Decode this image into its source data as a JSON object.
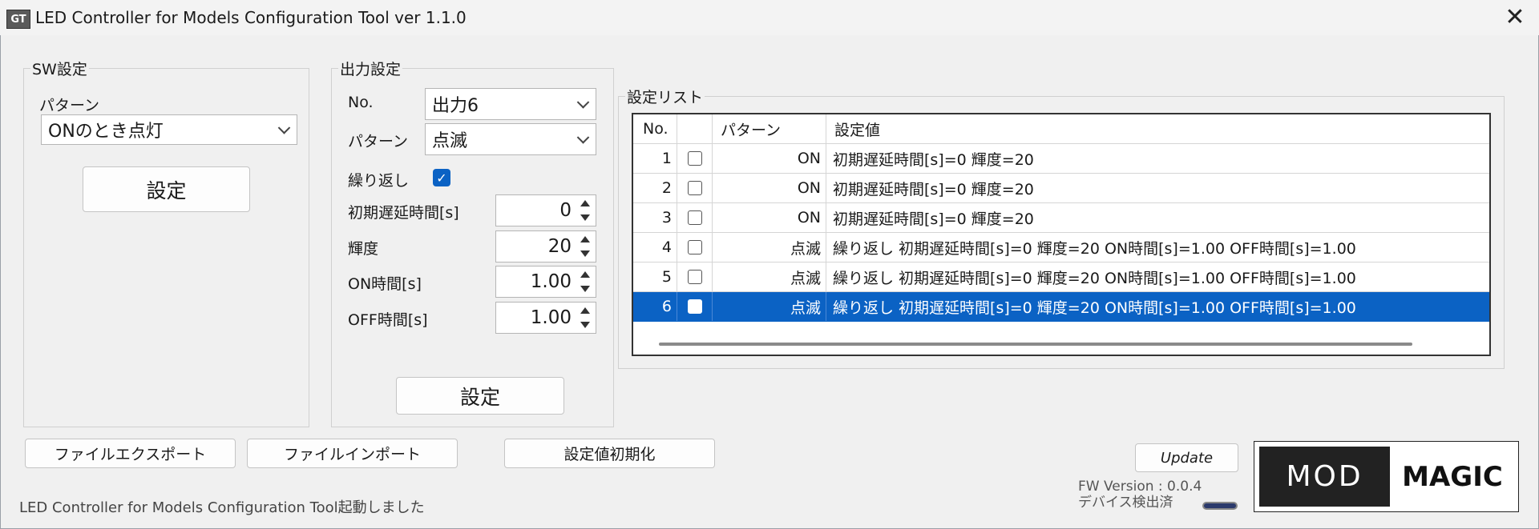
{
  "window": {
    "icon_text": "GT",
    "title": "LED Controller for Models Configuration Tool ver 1.1.0",
    "close_glyph": "✕"
  },
  "sw_group": {
    "legend": "SW設定",
    "pattern_label": "パターン",
    "pattern_value": "ONのとき点灯",
    "set_button": "設定"
  },
  "output_group": {
    "legend": "出力設定",
    "no_label": "No.",
    "no_value": "出力6",
    "pattern_label": "パターン",
    "pattern_value": "点滅",
    "repeat_label": "繰り返し",
    "repeat_checked": true,
    "delay_label": "初期遅延時間[s]",
    "delay_value": "0",
    "brightness_label": "輝度",
    "brightness_value": "20",
    "on_time_label": "ON時間[s]",
    "on_time_value": "1.00",
    "off_time_label": "OFF時間[s]",
    "off_time_value": "1.00",
    "set_button": "設定"
  },
  "list_group": {
    "legend": "設定リスト",
    "columns": [
      "No.",
      "",
      "パターン",
      "設定値"
    ],
    "rows": [
      {
        "no": "1",
        "pattern": "ON",
        "value": "初期遅延時間[s]=0 輝度=20",
        "selected": false
      },
      {
        "no": "2",
        "pattern": "ON",
        "value": "初期遅延時間[s]=0 輝度=20",
        "selected": false
      },
      {
        "no": "3",
        "pattern": "ON",
        "value": "初期遅延時間[s]=0 輝度=20",
        "selected": false
      },
      {
        "no": "4",
        "pattern": "点滅",
        "value": "繰り返し 初期遅延時間[s]=0 輝度=20 ON時間[s]=1.00 OFF時間[s]=1.00",
        "selected": false
      },
      {
        "no": "5",
        "pattern": "点滅",
        "value": "繰り返し 初期遅延時間[s]=0 輝度=20 ON時間[s]=1.00 OFF時間[s]=1.00",
        "selected": false
      },
      {
        "no": "6",
        "pattern": "点滅",
        "value": "繰り返し 初期遅延時間[s]=0 輝度=20 ON時間[s]=1.00 OFF時間[s]=1.00",
        "selected": true
      }
    ]
  },
  "bottom": {
    "export_button": "ファイルエクスポート",
    "import_button": "ファイルインポート",
    "reset_button": "設定値初期化",
    "update_button": "Update",
    "fw_version": "FW Version : 0.0.4",
    "device_status": "デバイス検出済",
    "status_message": "LED Controller for Models Configuration Tool起動しました"
  },
  "logo": {
    "left_text": "MOD",
    "right_text": "MAGIC"
  },
  "colors": {
    "selection": "#0b62c4",
    "checkbox_accent": "#0b62c4",
    "background": "#f0f0f0"
  }
}
